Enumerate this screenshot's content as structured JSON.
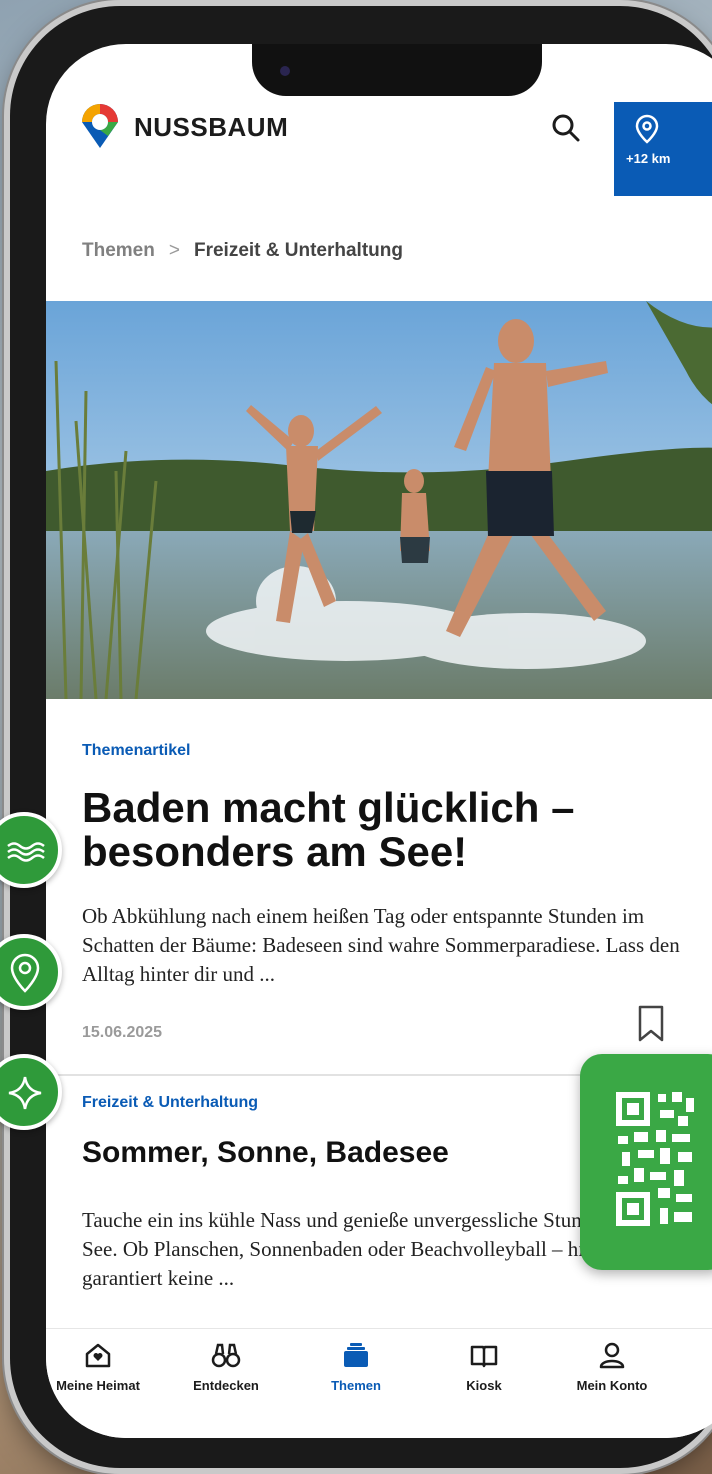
{
  "brand": {
    "name": "NUSSBAUM",
    "logo_icon": "pin-logo-icon"
  },
  "header": {
    "search_icon": "search-icon",
    "location_label": "+12 km",
    "location_icon": "location-pin-icon"
  },
  "breadcrumb": {
    "parent": "Themen",
    "separator": ">",
    "current": "Freizeit & Unterhaltung"
  },
  "article1": {
    "category": "Themenartikel",
    "title": "Baden macht glücklich – besonders am See!",
    "teaser": "Ob Abkühlung nach einem heißen Tag oder entspannte Stunden im Schatten der Bäume: Badeseen sind wahre Sommerparadiese. Lass den Alltag hinter dir und ...",
    "date": "15.06.2025"
  },
  "article2": {
    "category": "Freizeit & Unterhaltung",
    "title": "Sommer, Sonne, Badesee",
    "teaser": "Tauche ein ins kühle Nass und genieße unvergessliche Stunden am See. Ob Planschen, Sonnenbaden oder Beachvolleyball – hier kommt garantiert keine ..."
  },
  "nav": [
    {
      "label": "Meine Heimat",
      "icon": "home-heart-icon"
    },
    {
      "label": "Entdecken",
      "icon": "binoculars-icon"
    },
    {
      "label": "Themen",
      "icon": "stack-icon",
      "active": true
    },
    {
      "label": "Kiosk",
      "icon": "book-icon"
    },
    {
      "label": "Mein Konto",
      "icon": "user-icon"
    }
  ],
  "colors": {
    "accent": "#0a5bb5",
    "badge_green": "#2f9a3a"
  }
}
